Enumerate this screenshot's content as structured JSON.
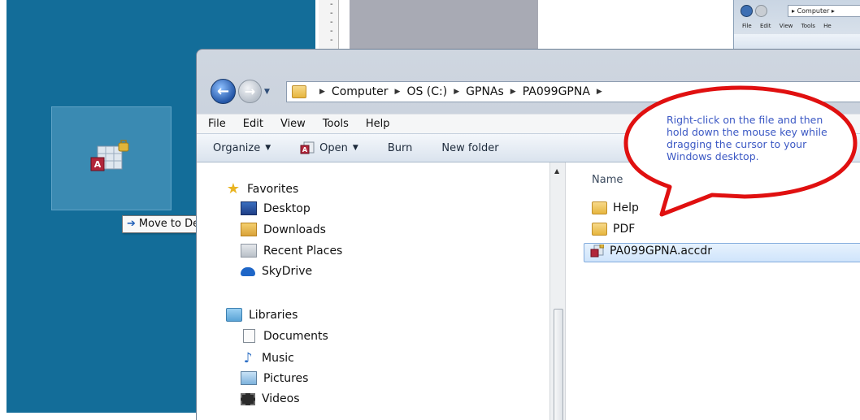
{
  "window": {
    "address_crumbs": [
      "Computer",
      "OS (C:)",
      "GPNAs",
      "PA099GPNA"
    ],
    "menu": [
      "File",
      "Edit",
      "View",
      "Tools",
      "Help"
    ],
    "toolbar": {
      "organize": "Organize",
      "open": "Open",
      "burn": "Burn",
      "new_folder": "New folder"
    },
    "nav_pane": {
      "favorites_label": "Favorites",
      "favorites": [
        "Desktop",
        "Downloads",
        "Recent Places",
        "SkyDrive"
      ],
      "libraries_label": "Libraries",
      "libraries": [
        "Documents",
        "Music",
        "Pictures",
        "Videos"
      ]
    },
    "content": {
      "column_name": "Name",
      "items": [
        {
          "name": "Help",
          "type": "folder"
        },
        {
          "name": "PDF",
          "type": "folder"
        },
        {
          "name": "PA099GPNA.accdr",
          "type": "access-runtime-file",
          "selected": true
        }
      ]
    }
  },
  "drag_tooltip": "Move to Desktop",
  "callout_text": "Right-click on the file and then hold down the mouse key while dragging the cursor to your Windows desktop.",
  "background_window": {
    "address_text": "Computer",
    "menu": [
      "File",
      "Edit",
      "View",
      "Tools",
      "He"
    ]
  },
  "colors": {
    "desktop": "#136d99",
    "callout_border": "#e01010",
    "callout_text": "#3b58c4",
    "selection": "#cfe4fb"
  }
}
